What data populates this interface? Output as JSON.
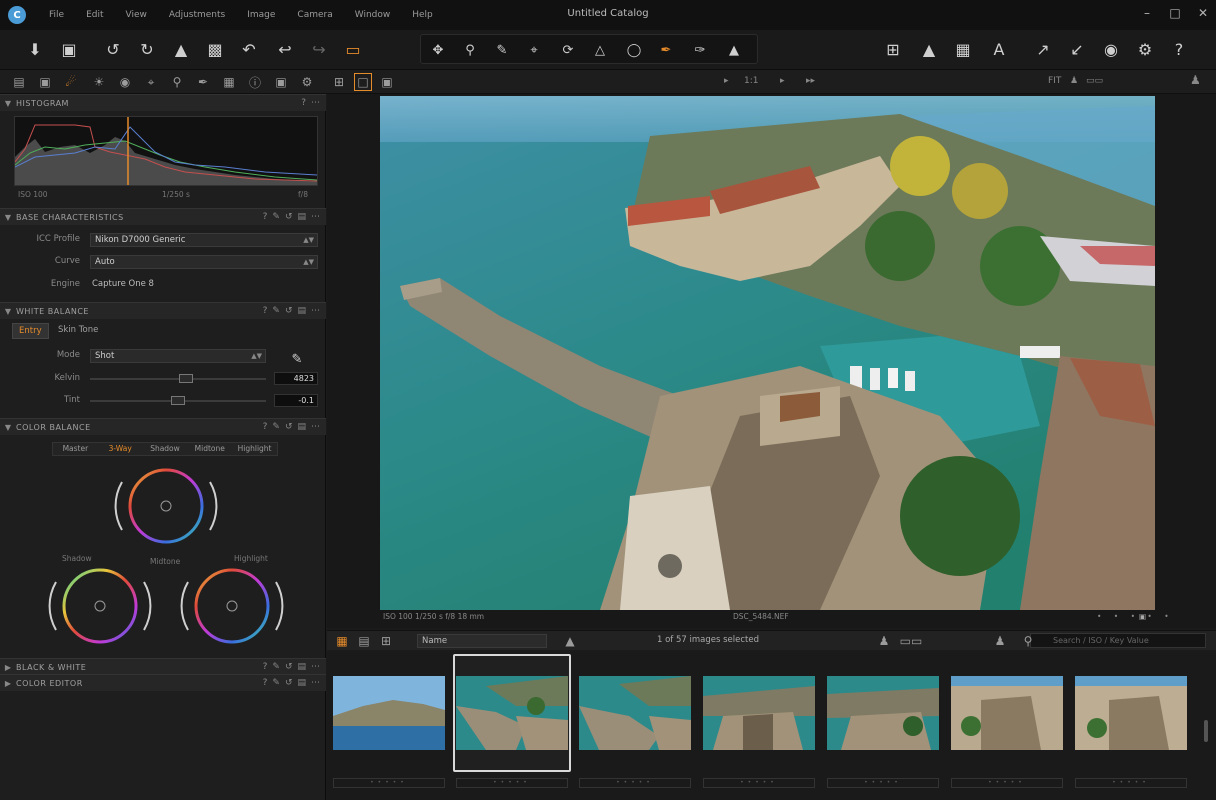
{
  "app": {
    "window_title": "Untitled Catalog",
    "menu": [
      "File",
      "Edit",
      "View",
      "Adjustments",
      "Image",
      "Camera",
      "Window",
      "Help"
    ]
  },
  "toolbar": {
    "left_icons": [
      "import-icon",
      "camera-icon",
      "rotate-left-icon",
      "rotate-right-icon",
      "auto-adjust-icon",
      "delete-icon",
      "undo-icon",
      "undo-all-icon",
      "redo-icon",
      "batch-folder-icon"
    ],
    "cursor_tools": [
      "pan-icon",
      "zoom-icon",
      "picker-icon",
      "crop-icon",
      "rotate-tool-icon",
      "keystone-icon",
      "spot-icon",
      "brush-icon",
      "eraser-icon",
      "gradient-icon"
    ],
    "right_icons": [
      "grid-icon",
      "exposure-warning-icon",
      "proof-icon",
      "focus-mask-icon",
      "copy-adjust-icon",
      "apply-adjust-icon",
      "preview-icon",
      "settings-icon",
      "help-icon"
    ]
  },
  "tool_tabs": {
    "viewer_zoom": "1:1",
    "viewer_mode": "FIT"
  },
  "histogram": {
    "title": "HISTOGRAM",
    "labels": [
      "ISO 100",
      "1/250 s",
      "f/8"
    ]
  },
  "basic": {
    "title": "BASE CHARACTERISTICS",
    "icc_label": "ICC Profile",
    "icc_value": "Nikon D7000 Generic",
    "curve_label": "Curve",
    "curve_value": "Auto",
    "engine_label": "Engine",
    "engine_value": "Capture One 8"
  },
  "white_balance": {
    "title": "WHITE BALANCE",
    "tabs": [
      "Entry",
      "Skin Tone"
    ],
    "active_tab": 0,
    "mode_label": "Mode",
    "mode_value": "Shot",
    "kelvin_label": "Kelvin",
    "kelvin_value": "4823",
    "kelvin_level": 0.55,
    "tint_label": "Tint",
    "tint_value": "-0.1",
    "tint_level": 0.5
  },
  "color_balance": {
    "title": "COLOR BALANCE",
    "tabs": [
      "Master",
      "3-Way",
      "Shadow",
      "Midtone",
      "Highlight"
    ],
    "active_tab": 1,
    "wheel_labels": [
      "Shadow",
      "Midtone",
      "Highlight"
    ]
  },
  "collapsed_sections": [
    "BLACK & WHITE",
    "COLOR EDITOR"
  ],
  "viewer": {
    "caption_left": "ISO 100  1/250 s  f/8  18 mm",
    "caption_center": "DSC_5484.NEF"
  },
  "browser": {
    "sort_value": "Name",
    "selection_text": "1 of 57 images selected",
    "search_placeholder": "Search / ISO / Key Value",
    "thumbnails": [
      "sky",
      "selected",
      "harbor",
      "harbor",
      "harbor",
      "town",
      "town"
    ],
    "selected_index": 1
  }
}
